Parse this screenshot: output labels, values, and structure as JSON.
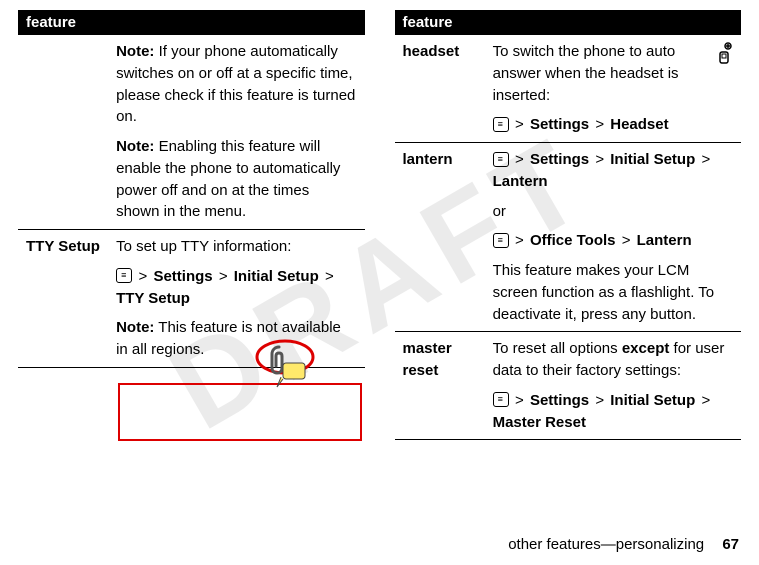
{
  "watermark": "DRAFT",
  "left": {
    "header": "feature",
    "row1": {
      "feat": "",
      "p1_label": "Note:",
      "p1_text": " If your phone automatically switches on or off at a specific time, please check if this feature is turned on.",
      "p2_label": "Note:",
      "p2_text": " Enabling this feature will enable the phone to automatically power off and on at the times shown in the menu."
    },
    "row2": {
      "feat": "TTY Setup",
      "p1": "To set up TTY information:",
      "path1_a": "Settings",
      "path1_b": "Initial Setup",
      "path1_c": "TTY Setup",
      "note_label": "Note:",
      "note_text": " This feature is not available in all regions."
    }
  },
  "right": {
    "header": "feature",
    "row1": {
      "feat": "headset",
      "p1": "To switch the phone to auto answer when the headset is inserted:",
      "path_a": "Settings",
      "path_b": "Headset"
    },
    "row2": {
      "feat": "lantern",
      "path1_a": "Settings",
      "path1_b": "Initial Setup",
      "path1_c": "Lantern",
      "or": "or",
      "path2_a": "Office Tools",
      "path2_b": "Lantern",
      "desc": "This feature makes your LCM screen function as a flashlight. To deactivate it, press any button."
    },
    "row3": {
      "feat": "master reset",
      "p1a": "To reset all options ",
      "p1b": "except",
      "p1c": " for user data to their factory settings:",
      "path_a": "Settings",
      "path_b": "Initial Setup",
      "path_c": "Master Reset"
    }
  },
  "footer": {
    "text": "other features—personalizing",
    "page": "67"
  },
  "gt": ">",
  "menukey": "≡"
}
